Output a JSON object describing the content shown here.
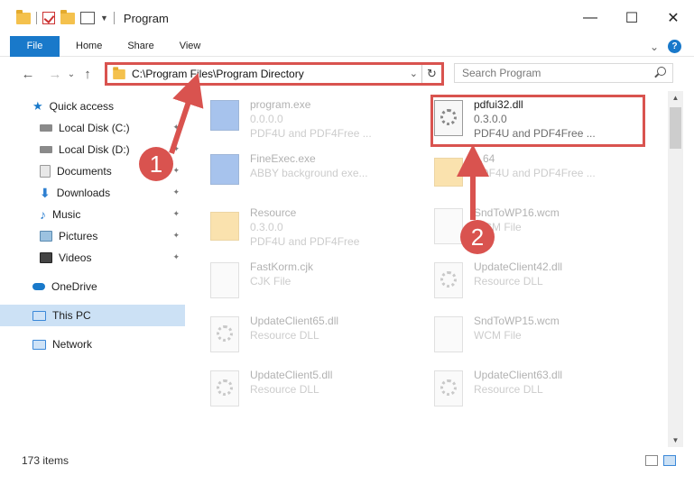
{
  "window": {
    "title": "Program",
    "controls": {
      "minimize": "—",
      "maximize": "☐",
      "close": "✕"
    }
  },
  "ribbon": {
    "file": "File",
    "tabs": [
      "Home",
      "Share",
      "View"
    ],
    "expand": "⌄",
    "help": "?"
  },
  "nav": {
    "back": "←",
    "forward": "→",
    "recent": "⌄",
    "up": "↑",
    "address": "C:\\Program Files\\Program Directory",
    "address_dropdown": "⌄",
    "refresh": "↻",
    "search_placeholder": "Search Program"
  },
  "sidebar": {
    "items": [
      {
        "label": "Quick access",
        "icon": "star-icon",
        "color": "#1979ca"
      },
      {
        "label": "Local Disk (C:)",
        "icon": "drive-icon",
        "color": "#7a7a7a",
        "pinned": true
      },
      {
        "label": "Local Disk (D:)",
        "icon": "drive-icon",
        "color": "#7a7a7a",
        "pinned": true
      },
      {
        "label": "Documents",
        "icon": "documents-icon",
        "color": "#9a9a9a",
        "pinned": true
      },
      {
        "label": "Downloads",
        "icon": "download-icon",
        "color": "#2f80d1",
        "pinned": true
      },
      {
        "label": "Music",
        "icon": "music-icon",
        "color": "#2f80d1",
        "pinned": true
      },
      {
        "label": "Pictures",
        "icon": "pictures-icon",
        "color": "#5a8ab0",
        "pinned": true
      },
      {
        "label": "Videos",
        "icon": "videos-icon",
        "color": "#555555",
        "pinned": true
      },
      {
        "label": "OneDrive",
        "icon": "cloud-icon",
        "color": "#1979ca"
      },
      {
        "label": "This PC",
        "icon": "computer-icon",
        "color": "#3b88d8",
        "selected": true
      },
      {
        "label": "Network",
        "icon": "network-icon",
        "color": "#3b88d8"
      }
    ],
    "pin_glyph": "✦"
  },
  "files": [
    {
      "name": "program.exe",
      "line1": "0.0.0.0",
      "line2": "PDF4U and PDF4Free ...",
      "type": "exe"
    },
    {
      "name": "pdfui32.dll",
      "line1": "0.3.0.0",
      "line2": "PDF4U and PDF4Free ...",
      "type": "dll",
      "highlighted": true
    },
    {
      "name": "FineExec.exe",
      "line1": "ABBY background exe...",
      "line2": "",
      "type": "exe"
    },
    {
      "name": "...64",
      "line1": "",
      "line2": "PDF4U and PDF4Free ...",
      "type": "folder"
    },
    {
      "name": "Resource",
      "line1": "0.3.0.0",
      "line2": "PDF4U and PDF4Free",
      "type": "folder"
    },
    {
      "name": "SndToWP16.wcm",
      "line1": "WCM File",
      "line2": "",
      "type": "file"
    },
    {
      "name": "FastKorm.cjk",
      "line1": "CJK File",
      "line2": "",
      "type": "file"
    },
    {
      "name": "UpdateClient42.dll",
      "line1": "Resource DLL",
      "line2": "",
      "type": "dll"
    },
    {
      "name": "UpdateClient65.dll",
      "line1": "Resource DLL",
      "line2": "",
      "type": "dll"
    },
    {
      "name": "SndToWP15.wcm",
      "line1": "WCM File",
      "line2": "",
      "type": "file"
    },
    {
      "name": "UpdateClient5.dll",
      "line1": "Resource DLL",
      "line2": "",
      "type": "dll"
    },
    {
      "name": "UpdateClient63.dll",
      "line1": "Resource DLL",
      "line2": "",
      "type": "dll"
    }
  ],
  "status": {
    "count": "173 items"
  },
  "annotations": {
    "step1": "1",
    "step2": "2",
    "accent": "#d9534f"
  }
}
